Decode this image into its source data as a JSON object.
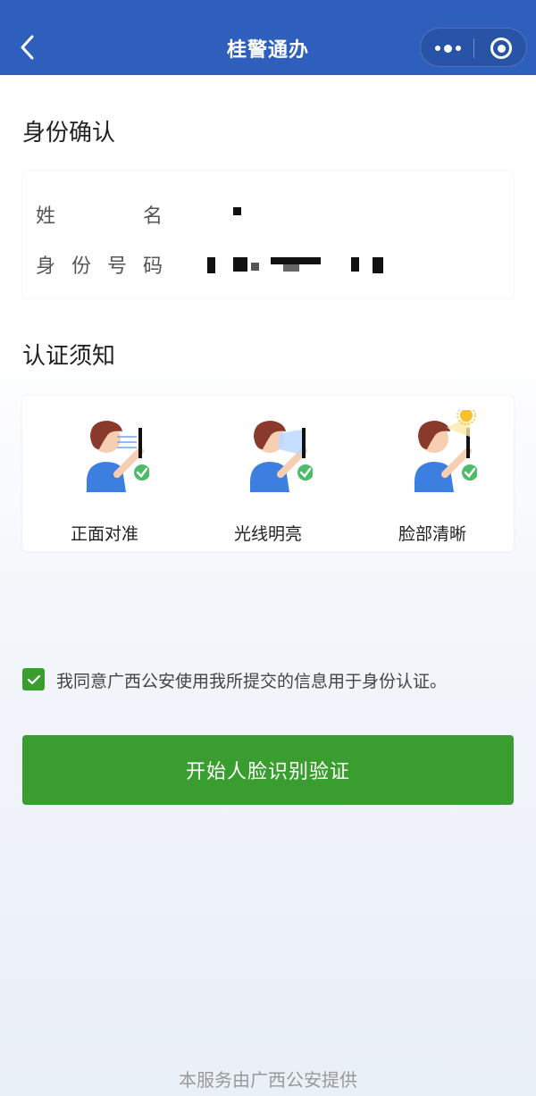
{
  "navbar": {
    "title": "桂警通办",
    "back_icon": "chevron-left-icon",
    "more_icon": "more-dots-icon",
    "close_icon": "target-close-icon",
    "color": "#2f5fbd"
  },
  "identity": {
    "heading": "身份确认",
    "name_label": "姓名",
    "id_label": "身份号码"
  },
  "notice": {
    "heading": "认证须知",
    "tips": [
      {
        "label": "正面对准",
        "icon": "face-front-icon"
      },
      {
        "label": "光线明亮",
        "icon": "bright-light-icon"
      },
      {
        "label": "脸部清晰",
        "icon": "clear-face-icon"
      }
    ]
  },
  "agreement": {
    "text": "我同意广西公安使用我所提交的信息用于身份认证。",
    "checked": true
  },
  "start_button": {
    "label": "开始人脸识别验证",
    "color": "#3a9d2f"
  },
  "footer": {
    "text": "本服务由广西公安提供"
  }
}
